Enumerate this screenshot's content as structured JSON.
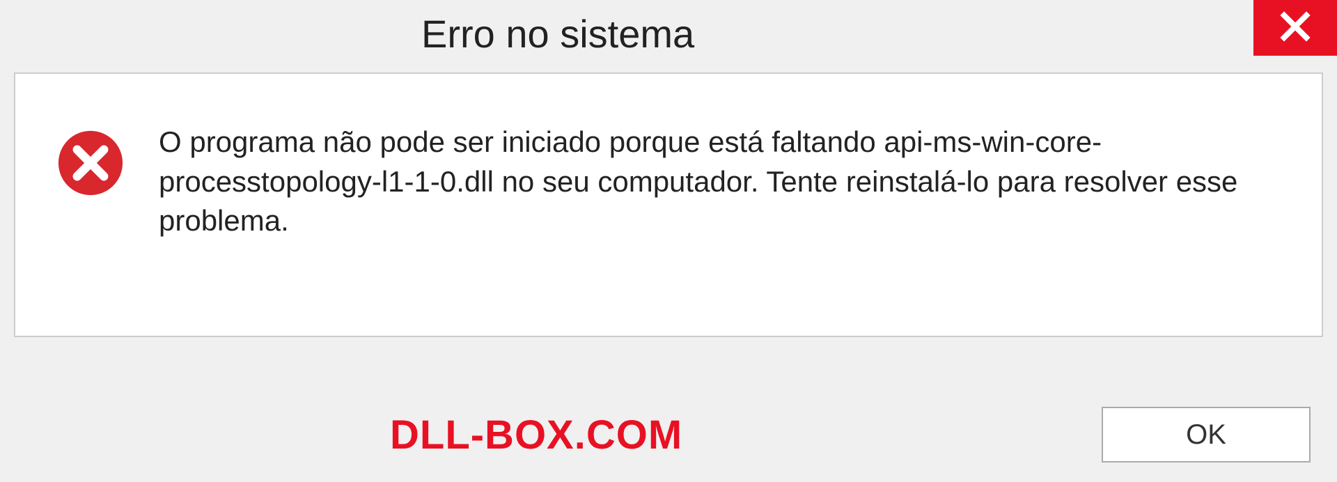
{
  "titlebar": {
    "title": "Erro no sistema",
    "close_icon": "close-icon"
  },
  "content": {
    "error_icon": "error-cross-icon",
    "message": "O programa não pode ser iniciado porque está faltando api-ms-win-core-processtopology-l1-1-0.dll no seu computador. Tente reinstalá-lo para resolver esse problema."
  },
  "footer": {
    "watermark": "DLL-BOX.COM",
    "ok_label": "OK"
  },
  "colors": {
    "close_bg": "#e81123",
    "error_icon_bg": "#d9272e",
    "watermark_color": "#e81123"
  }
}
